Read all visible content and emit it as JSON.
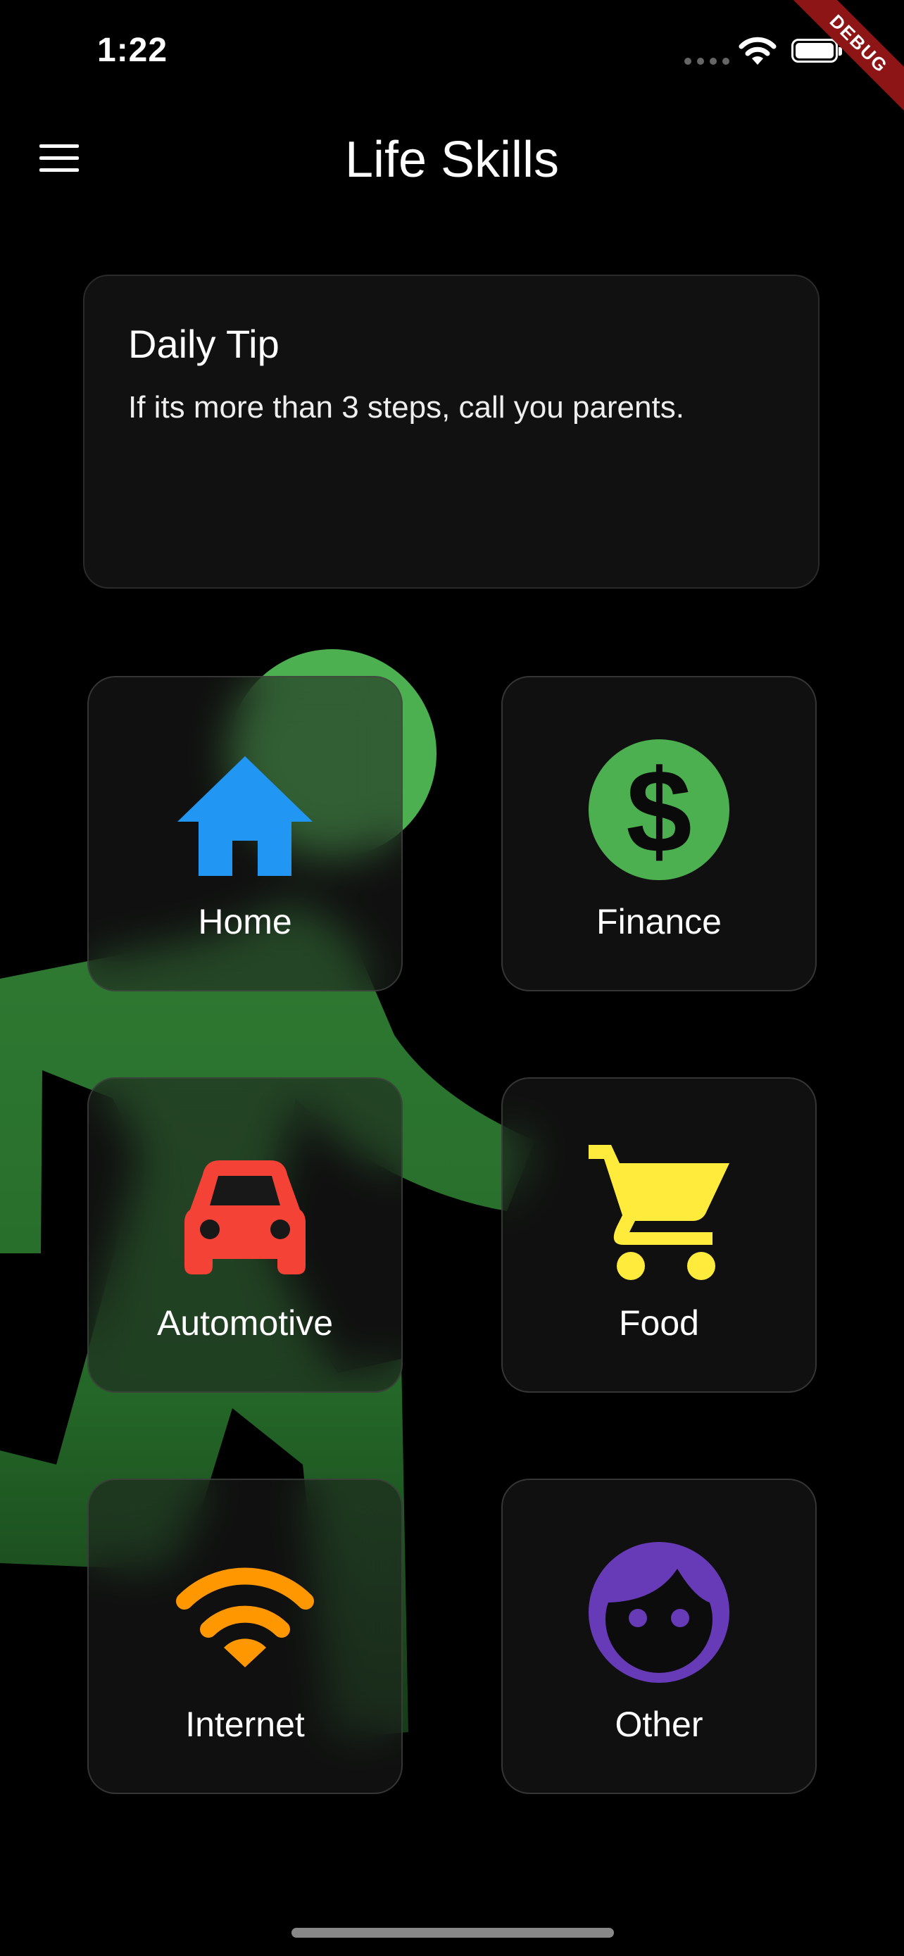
{
  "status_bar": {
    "time": "1:22",
    "debug_label": "DEBUG"
  },
  "app_bar": {
    "title": "Life Skills",
    "menu_icon": "hamburger-menu-icon"
  },
  "daily_tip": {
    "title": "Daily Tip",
    "text": "If its more than 3 steps, call you parents."
  },
  "categories": [
    {
      "label": "Home",
      "icon": "house-icon",
      "color": "#2196F3"
    },
    {
      "label": "Finance",
      "icon": "dollar-circle-icon",
      "color": "#4CAF50"
    },
    {
      "label": "Automotive",
      "icon": "car-icon",
      "color": "#F44336"
    },
    {
      "label": "Food",
      "icon": "shopping-cart-icon",
      "color": "#FFEB3B"
    },
    {
      "label": "Internet",
      "icon": "wifi-icon",
      "color": "#FF9800"
    },
    {
      "label": "Other",
      "icon": "face-icon",
      "color": "#673AB7"
    }
  ],
  "colors": {
    "background": "#000000",
    "figure": "#2E7D32",
    "card": "#111111"
  }
}
